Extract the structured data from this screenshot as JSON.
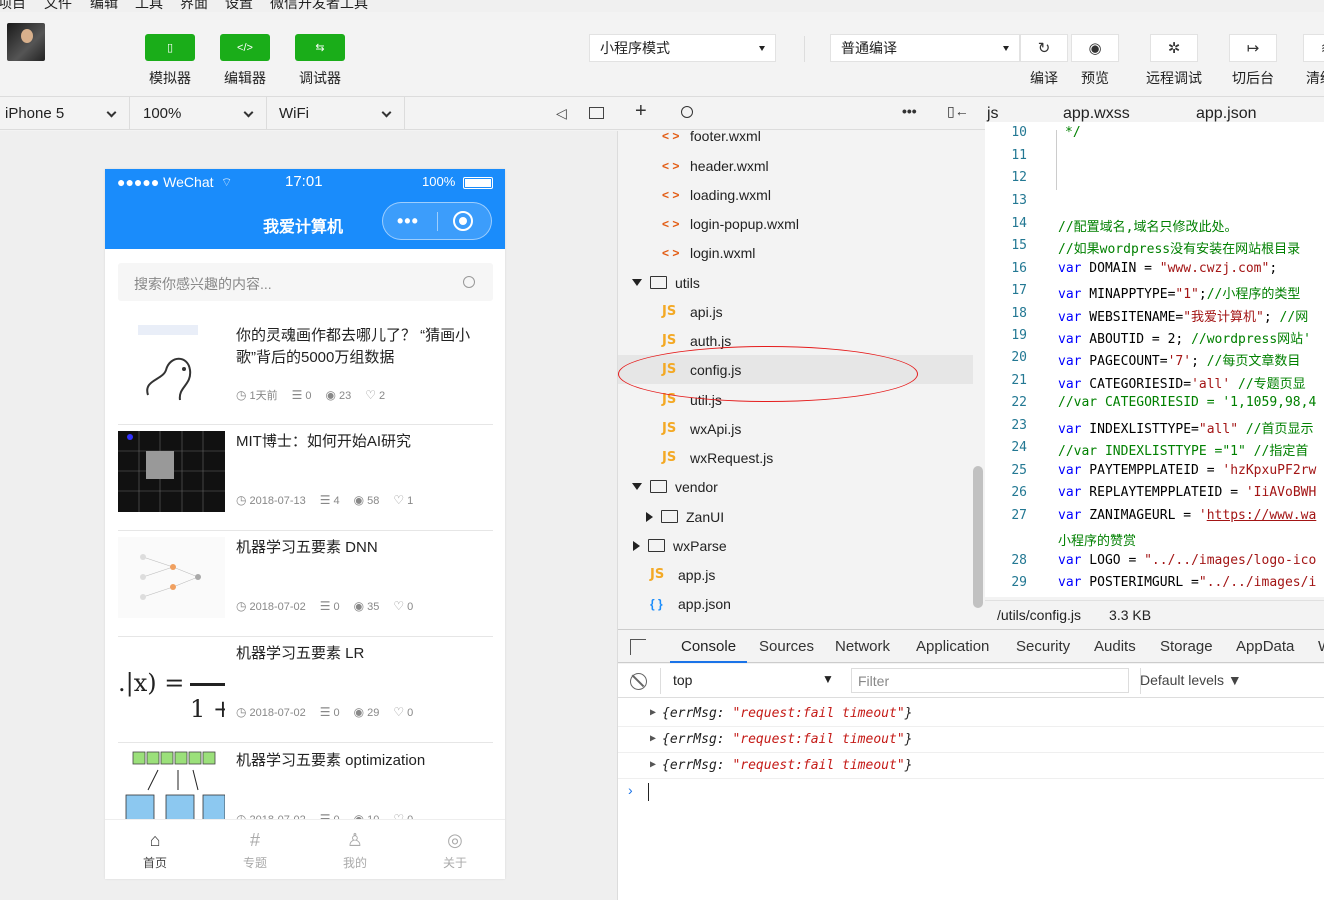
{
  "menubar": [
    "项目",
    "文件",
    "编辑",
    "工具",
    "界面",
    "设置",
    "微信开发者工具"
  ],
  "toolbar": {
    "green_buttons": [
      {
        "label": "模拟器",
        "icon": "phone-icon",
        "glyph": "▯"
      },
      {
        "label": "编辑器",
        "icon": "code-icon",
        "glyph": "</>"
      },
      {
        "label": "调试器",
        "icon": "debug-icon",
        "glyph": "⇆"
      }
    ],
    "mode_select": "小程序模式",
    "compile_select": "普通编译",
    "buttons": [
      {
        "label": "编译",
        "glyph": "↻"
      },
      {
        "label": "预览",
        "glyph": "◉"
      },
      {
        "label": "远程调试",
        "glyph": "✲"
      },
      {
        "label": "切后台",
        "glyph": "↦"
      },
      {
        "label": "清缓存",
        "glyph": "≋"
      }
    ]
  },
  "simbar": {
    "device": "iPhone 5",
    "zoom": "100%",
    "network": "WiFi"
  },
  "phone": {
    "status": {
      "carrier": "●●●●● WeChat",
      "time": "17:01",
      "battery": "100%"
    },
    "nav_title": "我爱计算机",
    "search_placeholder": "搜索你感兴趣的内容...",
    "posts": [
      {
        "title": "你的灵魂画作都去哪儿了？ “猜画小歌”背后的5000万组数据",
        "date": "1天前",
        "comments": "0",
        "views": "23",
        "likes": "2"
      },
      {
        "title": "MIT博士：如何开始AI研究",
        "date": "2018-07-13",
        "comments": "4",
        "views": "58",
        "likes": "1"
      },
      {
        "title": "机器学习五要素 DNN",
        "date": "2018-07-02",
        "comments": "0",
        "views": "35",
        "likes": "0"
      },
      {
        "title": "机器学习五要素 LR",
        "date": "2018-07-02",
        "comments": "0",
        "views": "29",
        "likes": "0"
      },
      {
        "title": "机器学习五要素 optimization",
        "date": "2018-07-02",
        "comments": "0",
        "views": "10",
        "likes": "0"
      }
    ],
    "tabs": [
      "首页",
      "专题",
      "我的",
      "关于"
    ],
    "accent": "#1a8cfb"
  },
  "filetree": {
    "items": [
      {
        "name": "footer.wxml",
        "type": "wxml"
      },
      {
        "name": "header.wxml",
        "type": "wxml"
      },
      {
        "name": "loading.wxml",
        "type": "wxml"
      },
      {
        "name": "login-popup.wxml",
        "type": "wxml"
      },
      {
        "name": "login.wxml",
        "type": "wxml"
      },
      {
        "name": "utils",
        "type": "folder-open"
      },
      {
        "name": "api.js",
        "type": "js"
      },
      {
        "name": "auth.js",
        "type": "js"
      },
      {
        "name": "config.js",
        "type": "js",
        "selected": true
      },
      {
        "name": "util.js",
        "type": "js"
      },
      {
        "name": "wxApi.js",
        "type": "js"
      },
      {
        "name": "wxRequest.js",
        "type": "js"
      },
      {
        "name": "vendor",
        "type": "folder-open"
      },
      {
        "name": "ZanUI",
        "type": "folder-closed"
      },
      {
        "name": "wxParse",
        "type": "folder-closed"
      },
      {
        "name": "app.js",
        "type": "js"
      },
      {
        "name": "app.json",
        "type": "json"
      }
    ]
  },
  "editor": {
    "tabs": [
      "js",
      "app.wxss",
      "app.json"
    ],
    "status_path": "/utils/config.js",
    "status_size": "3.3 KB"
  },
  "devtools": {
    "tabs": [
      "Console",
      "Sources",
      "Network",
      "Application",
      "Security",
      "Audits",
      "Storage",
      "AppData",
      "W"
    ],
    "context": "top",
    "filter_placeholder": "Filter",
    "levels": "Default levels ▼",
    "messages": [
      {
        "key": "{errMsg: ",
        "val": "\"request:fail timeout\"",
        "end": "}"
      },
      {
        "key": "{errMsg: ",
        "val": "\"request:fail timeout\"",
        "end": "}"
      },
      {
        "key": "{errMsg: ",
        "val": "\"request:fail timeout\"",
        "end": "}"
      }
    ]
  }
}
